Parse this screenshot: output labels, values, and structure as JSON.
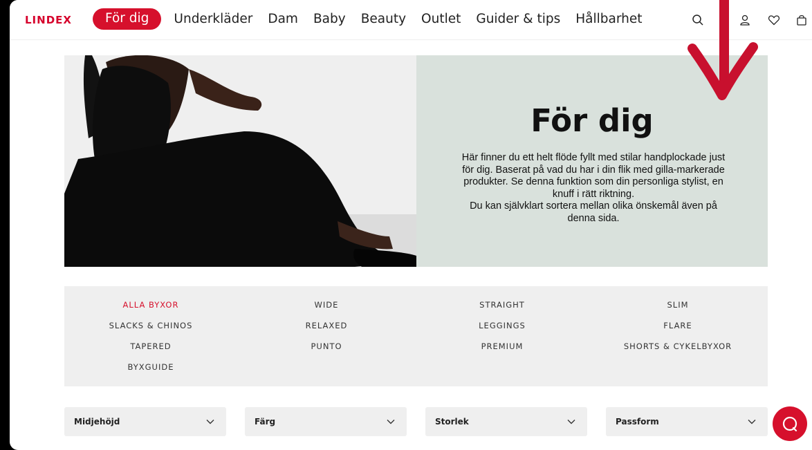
{
  "brand": {
    "logo": "LINDEX",
    "accent": "#d6102c"
  },
  "nav": {
    "items": [
      {
        "label": "För dig",
        "active": true
      },
      {
        "label": "Underkläder"
      },
      {
        "label": "Dam"
      },
      {
        "label": "Baby"
      },
      {
        "label": "Beauty"
      },
      {
        "label": "Outlet"
      },
      {
        "label": "Guider & tips"
      },
      {
        "label": "Hållbarhet"
      }
    ],
    "icons": [
      "search-icon",
      "account-icon",
      "heart-icon",
      "bag-icon"
    ]
  },
  "hero": {
    "title": "För dig",
    "text": "Här finner du ett helt flöde fyllt med stilar handplockade just för dig. Baserat på vad du har i din flik med gilla-markerade produkter. Se denna funktion som din personliga stylist, en knuff i rätt riktning.\nDu kan självklart sortera mellan olika önskemål även på denna sida.",
    "panel_color": "#d9e1dc"
  },
  "categories": [
    {
      "label": "ALLA BYXOR",
      "active": true
    },
    {
      "label": "WIDE"
    },
    {
      "label": "STRAIGHT"
    },
    {
      "label": "SLIM"
    },
    {
      "label": "SLACKS & CHINOS"
    },
    {
      "label": "RELAXED"
    },
    {
      "label": "LEGGINGS"
    },
    {
      "label": "FLARE"
    },
    {
      "label": "TAPERED"
    },
    {
      "label": "PUNTO"
    },
    {
      "label": "PREMIUM"
    },
    {
      "label": "SHORTS & CYKELBYXOR"
    },
    {
      "label": "BYXGUIDE"
    }
  ],
  "filters": [
    {
      "label": "Midjehöjd"
    },
    {
      "label": "Färg"
    },
    {
      "label": "Storlek"
    },
    {
      "label": "Passform"
    }
  ],
  "chat": {
    "icon": "chat-icon"
  }
}
